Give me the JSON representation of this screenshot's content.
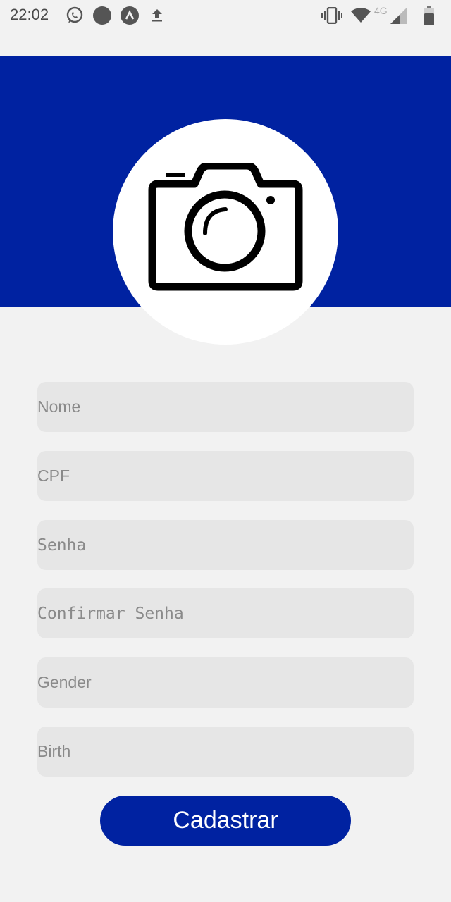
{
  "status_bar": {
    "time": "22:02",
    "network_label": "4G",
    "left_icons": [
      "whatsapp-icon",
      "circle-dot-icon",
      "app-circle-icon",
      "upload-icon"
    ],
    "right_icons": [
      "vibrate-icon",
      "wifi-icon",
      "signal-icon",
      "battery-icon"
    ]
  },
  "header": {
    "background_color": "#0022a1",
    "avatar_icon": "camera-icon"
  },
  "form": {
    "fields": [
      {
        "placeholder": "Nome",
        "value": ""
      },
      {
        "placeholder": "CPF",
        "value": ""
      },
      {
        "placeholder": "Senha",
        "value": ""
      },
      {
        "placeholder": "Confirmar Senha",
        "value": ""
      },
      {
        "placeholder": "Gender",
        "value": ""
      },
      {
        "placeholder": "Birth",
        "value": ""
      }
    ],
    "submit_label": "Cadastrar"
  },
  "colors": {
    "accent": "#0022a1",
    "page_background": "#f2f2f2",
    "field_background": "#e6e6e6"
  }
}
